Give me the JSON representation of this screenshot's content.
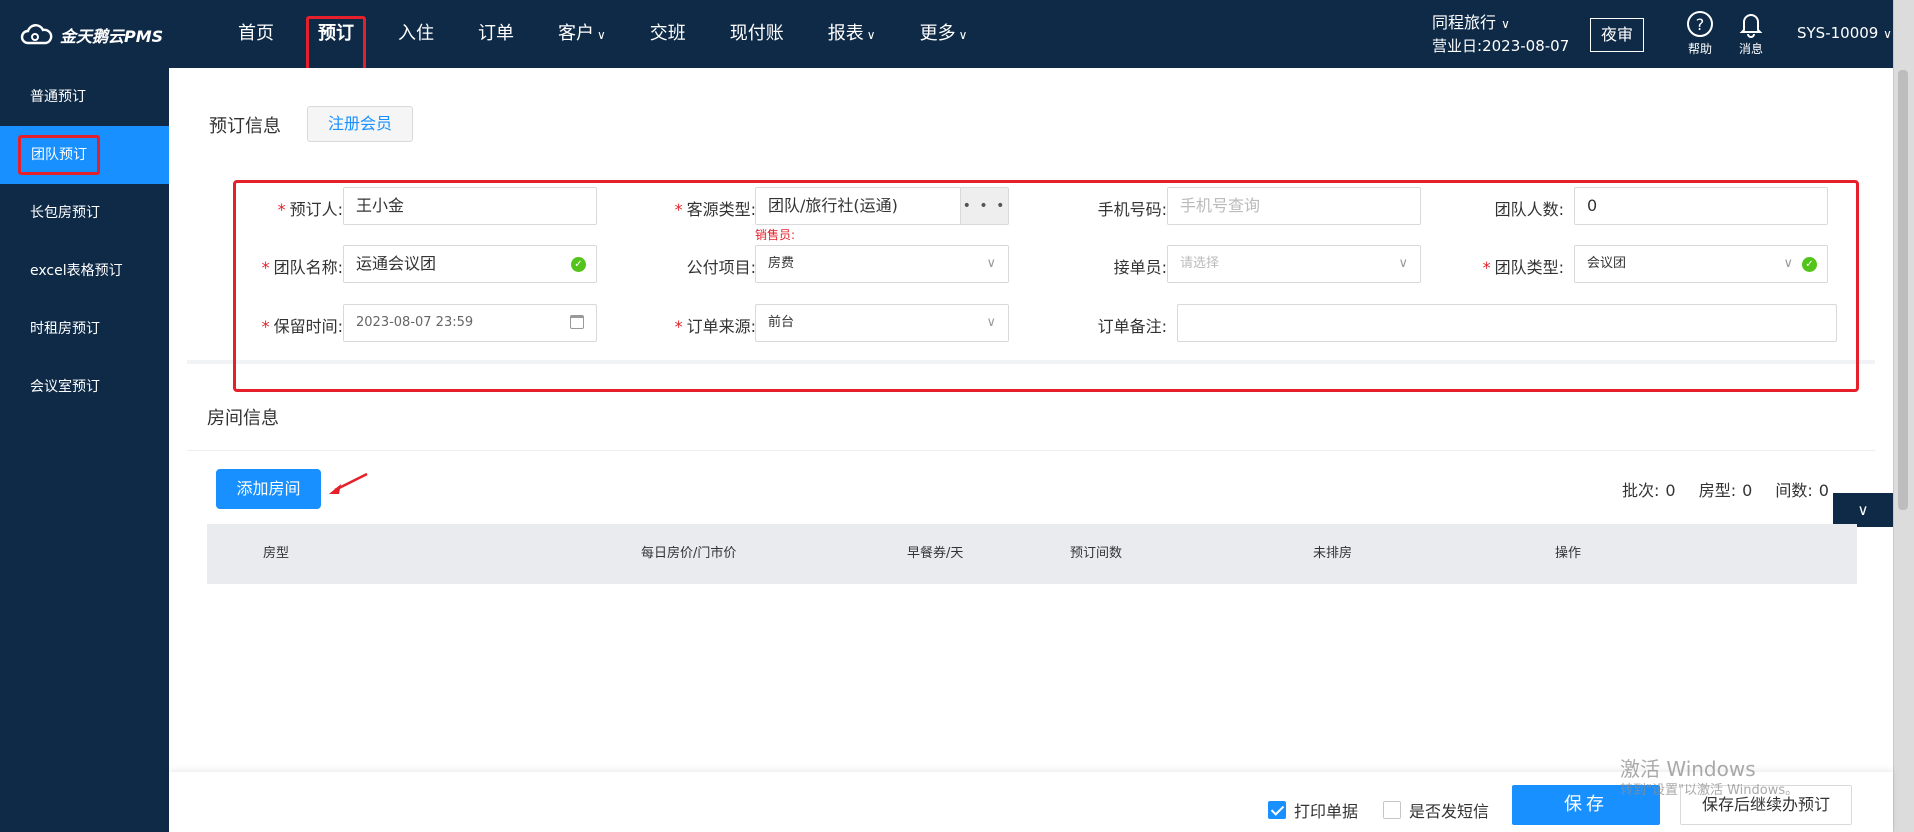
{
  "app": {
    "logo_text": "金天鹅云PMS"
  },
  "nav": [
    {
      "label": "首页",
      "caret": false
    },
    {
      "label": "预订",
      "caret": false,
      "active": true
    },
    {
      "label": "入住",
      "caret": false
    },
    {
      "label": "订单",
      "caret": false
    },
    {
      "label": "客户",
      "caret": true
    },
    {
      "label": "交班",
      "caret": false
    },
    {
      "label": "现付账",
      "caret": false
    },
    {
      "label": "报表",
      "caret": true
    },
    {
      "label": "更多",
      "caret": true
    }
  ],
  "header": {
    "org_name": "同程旅行",
    "business_day_label": "营业日:",
    "business_day": "2023-08-07",
    "night_audit": "夜审",
    "help": "帮助",
    "messages": "消息",
    "user": "SYS-10009"
  },
  "sidebar": {
    "items": [
      {
        "label": "普通预订"
      },
      {
        "label": "团队预订",
        "active": true
      },
      {
        "label": "长包房预订"
      },
      {
        "label": "excel表格预订"
      },
      {
        "label": "时租房预订"
      },
      {
        "label": "会议室预订"
      }
    ]
  },
  "booking": {
    "section_title": "预订信息",
    "register_member": "注册会员",
    "booker_label": "预订人:",
    "booker_value": "王小金",
    "source_label": "客源类型:",
    "source_value": "团队/旅行社(运通)",
    "sales_note": "销售员:",
    "phone_label": "手机号码:",
    "phone_placeholder": "手机号查询",
    "group_size_label": "团队人数:",
    "group_size_value": "0",
    "group_name_label": "团队名称:",
    "group_name_value": "运通会议团",
    "billing_label": "公付项目:",
    "billing_value": "房费",
    "receiver_label": "接单员:",
    "receiver_placeholder": "请选择",
    "group_type_label": "团队类型:",
    "group_type_value": "会议团",
    "hold_time_label": "保留时间:",
    "hold_time_value": "2023-08-07 23:59",
    "order_source_label": "订单来源:",
    "order_source_value": "前台",
    "remark_label": "订单备注:",
    "remark_value": ""
  },
  "rooms": {
    "section_title": "房间信息",
    "add_room": "添加房间",
    "batch_label": "批次:",
    "batch_value": "0",
    "room_type_label": "房型:",
    "room_type_value": "0",
    "room_count_label": "间数:",
    "room_count_value": "0",
    "columns": [
      "房型",
      "每日房价/门市价",
      "早餐券/天",
      "预订间数",
      "未排房",
      "操作"
    ]
  },
  "footer": {
    "print_receipt": "打印单据",
    "print_checked": true,
    "send_sms": "是否发短信",
    "sms_checked": false,
    "save": "保存",
    "save_continue": "保存后继续办预订"
  },
  "watermark": {
    "line1": "激活 Windows",
    "line2": "转到\"设置\"以激活 Windows。"
  },
  "colors": {
    "nav_bg": "#0e2a47",
    "accent": "#1890ff",
    "highlight": "#e5202a",
    "ok": "#52c41a"
  }
}
